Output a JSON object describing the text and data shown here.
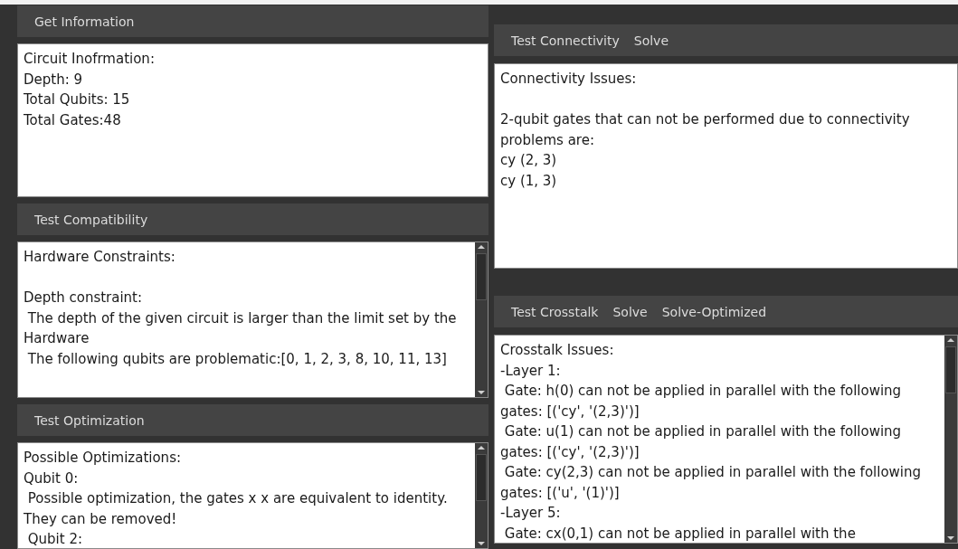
{
  "left_panels": [
    {
      "buttons": [
        "Get Information"
      ],
      "scrollbar": false,
      "blocks": [
        [
          "Circuit Inofrmation:",
          "Depth: 9",
          "Total Qubits: 15",
          "Total Gates:48"
        ]
      ]
    },
    {
      "buttons": [
        "Test Compatibility"
      ],
      "scrollbar": true,
      "blocks": [
        [
          "Hardware Constraints:"
        ],
        [
          "Depth constraint:",
          " The depth of the given circuit is larger than the limit set by the Hardware",
          " The following qubits are problematic:[0, 1, 2, 3, 8, 10, 11, 13]"
        ]
      ]
    },
    {
      "buttons": [
        "Test Optimization"
      ],
      "scrollbar": true,
      "blocks": [
        [
          "Possible Optimizations:",
          "Qubit 0:",
          " Possible optimization, the gates x x are equivalent to identity. They can be removed!",
          " Qubit 2:"
        ]
      ]
    }
  ],
  "right_panels": [
    {
      "buttons": [
        "Test Connectivity",
        "Solve"
      ],
      "scrollbar": false,
      "blocks": [
        [
          "Connectivity Issues:"
        ],
        [
          "2-qubit gates that can not be performed due to connectivity problems are:",
          "cy (2, 3)",
          "cy (1, 3)"
        ]
      ]
    },
    {
      "buttons": [
        "Test Crosstalk",
        "Solve",
        "Solve-Optimized"
      ],
      "scrollbar": true,
      "blocks": [
        [
          "Crosstalk Issues:",
          "-Layer 1:",
          " Gate: h(0) can not be applied in parallel with the following gates: [('cy', '(2,3)')]",
          " Gate: u(1) can not be applied in parallel with the following gates: [('cy', '(2,3)')]",
          " Gate: cy(2,3) can not be applied in parallel with the following gates: [('u', '(1)')]",
          "-Layer 5:",
          " Gate: cx(0,1) can not be applied in parallel with the"
        ]
      ]
    }
  ]
}
